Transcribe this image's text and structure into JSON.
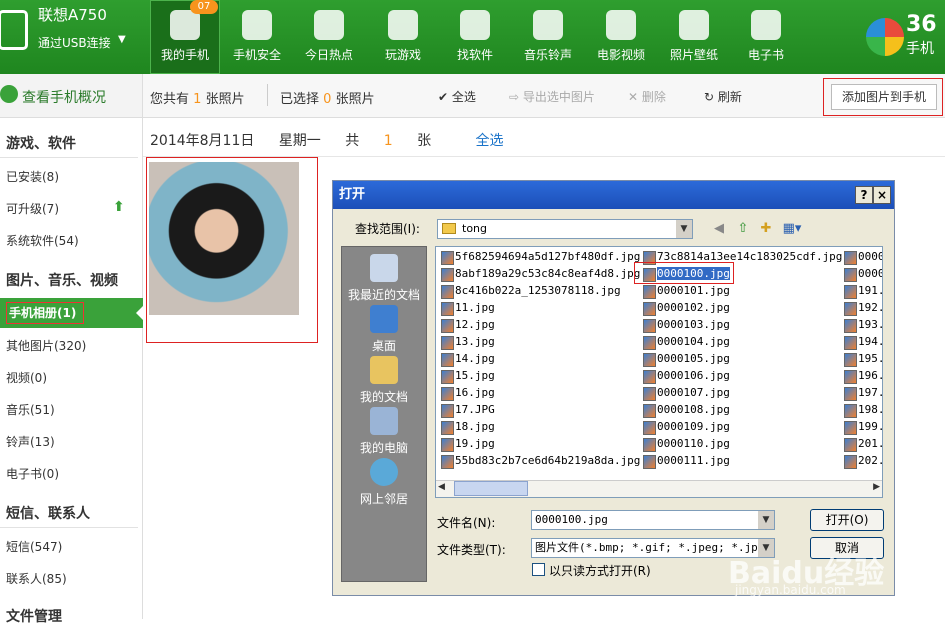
{
  "device": {
    "name": "联想A750",
    "connection": "通过USB连接",
    "caret": "▼"
  },
  "nav": [
    {
      "label": "我的手机",
      "icon": "phone-icon",
      "active": true
    },
    {
      "label": "手机安全",
      "icon": "shield-icon"
    },
    {
      "label": "今日热点",
      "icon": "star-icon"
    },
    {
      "label": "玩游戏",
      "icon": "gamepad-icon"
    },
    {
      "label": "找软件",
      "icon": "bag-icon"
    },
    {
      "label": "音乐铃声",
      "icon": "music-icon"
    },
    {
      "label": "电影视频",
      "icon": "film-icon"
    },
    {
      "label": "照片壁纸",
      "icon": "picture-icon"
    },
    {
      "label": "电子书",
      "icon": "book-icon"
    }
  ],
  "badge": "07",
  "brand": {
    "line1": "36",
    "line2": "手机"
  },
  "overview": "查看手机概况",
  "toolbar": {
    "total_pre": "您共有",
    "total_count": "1",
    "total_post": "张照片",
    "selected_pre": "已选择",
    "selected_count": "0",
    "selected_post": "张照片",
    "select_all": "全选",
    "export": "导出选中图片",
    "delete": "删除",
    "refresh": "刷新",
    "add": "添加图片到手机"
  },
  "sidebar": {
    "sec_games": "游戏、软件",
    "installed": "已安装(8)",
    "upgradable": "可升级(7)",
    "system": "系统软件(54)",
    "sec_media": "图片、音乐、视频",
    "album": "手机相册(1)",
    "other_pics": "其他图片(320)",
    "video": "视频(0)",
    "music": "音乐(51)",
    "ringtone": "铃声(13)",
    "ebook": "电子书(0)",
    "sec_sms": "短信、联系人",
    "sms": "短信(547)",
    "contacts": "联系人(85)",
    "sec_files": "文件管理"
  },
  "date_bar": {
    "date": "2014年8月11日",
    "weekday": "星期一",
    "total_pre": "共",
    "count": "1",
    "unit": "张",
    "select_all": "全选"
  },
  "dialog": {
    "title": "打开",
    "help": "?",
    "close": "×",
    "look_in_label": "查找范围(I):",
    "look_in_value": "tong",
    "places": [
      "我最近的文档",
      "桌面",
      "我的文档",
      "我的电脑",
      "网上邻居"
    ],
    "files_col1": [
      "5f682594694a5d127bf480df.jpg",
      "8abf189a29c53c84c8eaf4d8.jpg",
      "8c416b022a_1253078118.jpg",
      "11.jpg",
      "12.jpg",
      "13.jpg",
      "14.jpg",
      "15.jpg",
      "16.jpg",
      "17.JPG",
      "18.jpg",
      "19.jpg",
      "55bd83c2b7ce6d64b219a8da.jpg"
    ],
    "files_col2": [
      "73c8814a13ee14c183025cdf.jpg",
      "0000100.jpg",
      "0000101.jpg",
      "0000102.jpg",
      "0000103.jpg",
      "0000104.jpg",
      "0000105.jpg",
      "0000106.jpg",
      "0000107.jpg",
      "0000108.jpg",
      "0000109.jpg",
      "0000110.jpg",
      "0000111.jpg"
    ],
    "files_col3": [
      "0000",
      "0000",
      "191.",
      "192.",
      "193.",
      "194.",
      "195.",
      "196.",
      "197.",
      "198.",
      "199.",
      "201.",
      "202."
    ],
    "filename_label": "文件名(N):",
    "filename_value": "0000100.jpg",
    "filetype_label": "文件类型(T):",
    "filetype_value": "图片文件(*.bmp; *.gif; *.jpeg; *.jpg;",
    "open_btn": "打开(O)",
    "cancel_btn": "取消",
    "readonly_label": "以只读方式打开(R)"
  },
  "watermark": {
    "main": "Baidu经验",
    "sub": "jingyan.baidu.com"
  }
}
